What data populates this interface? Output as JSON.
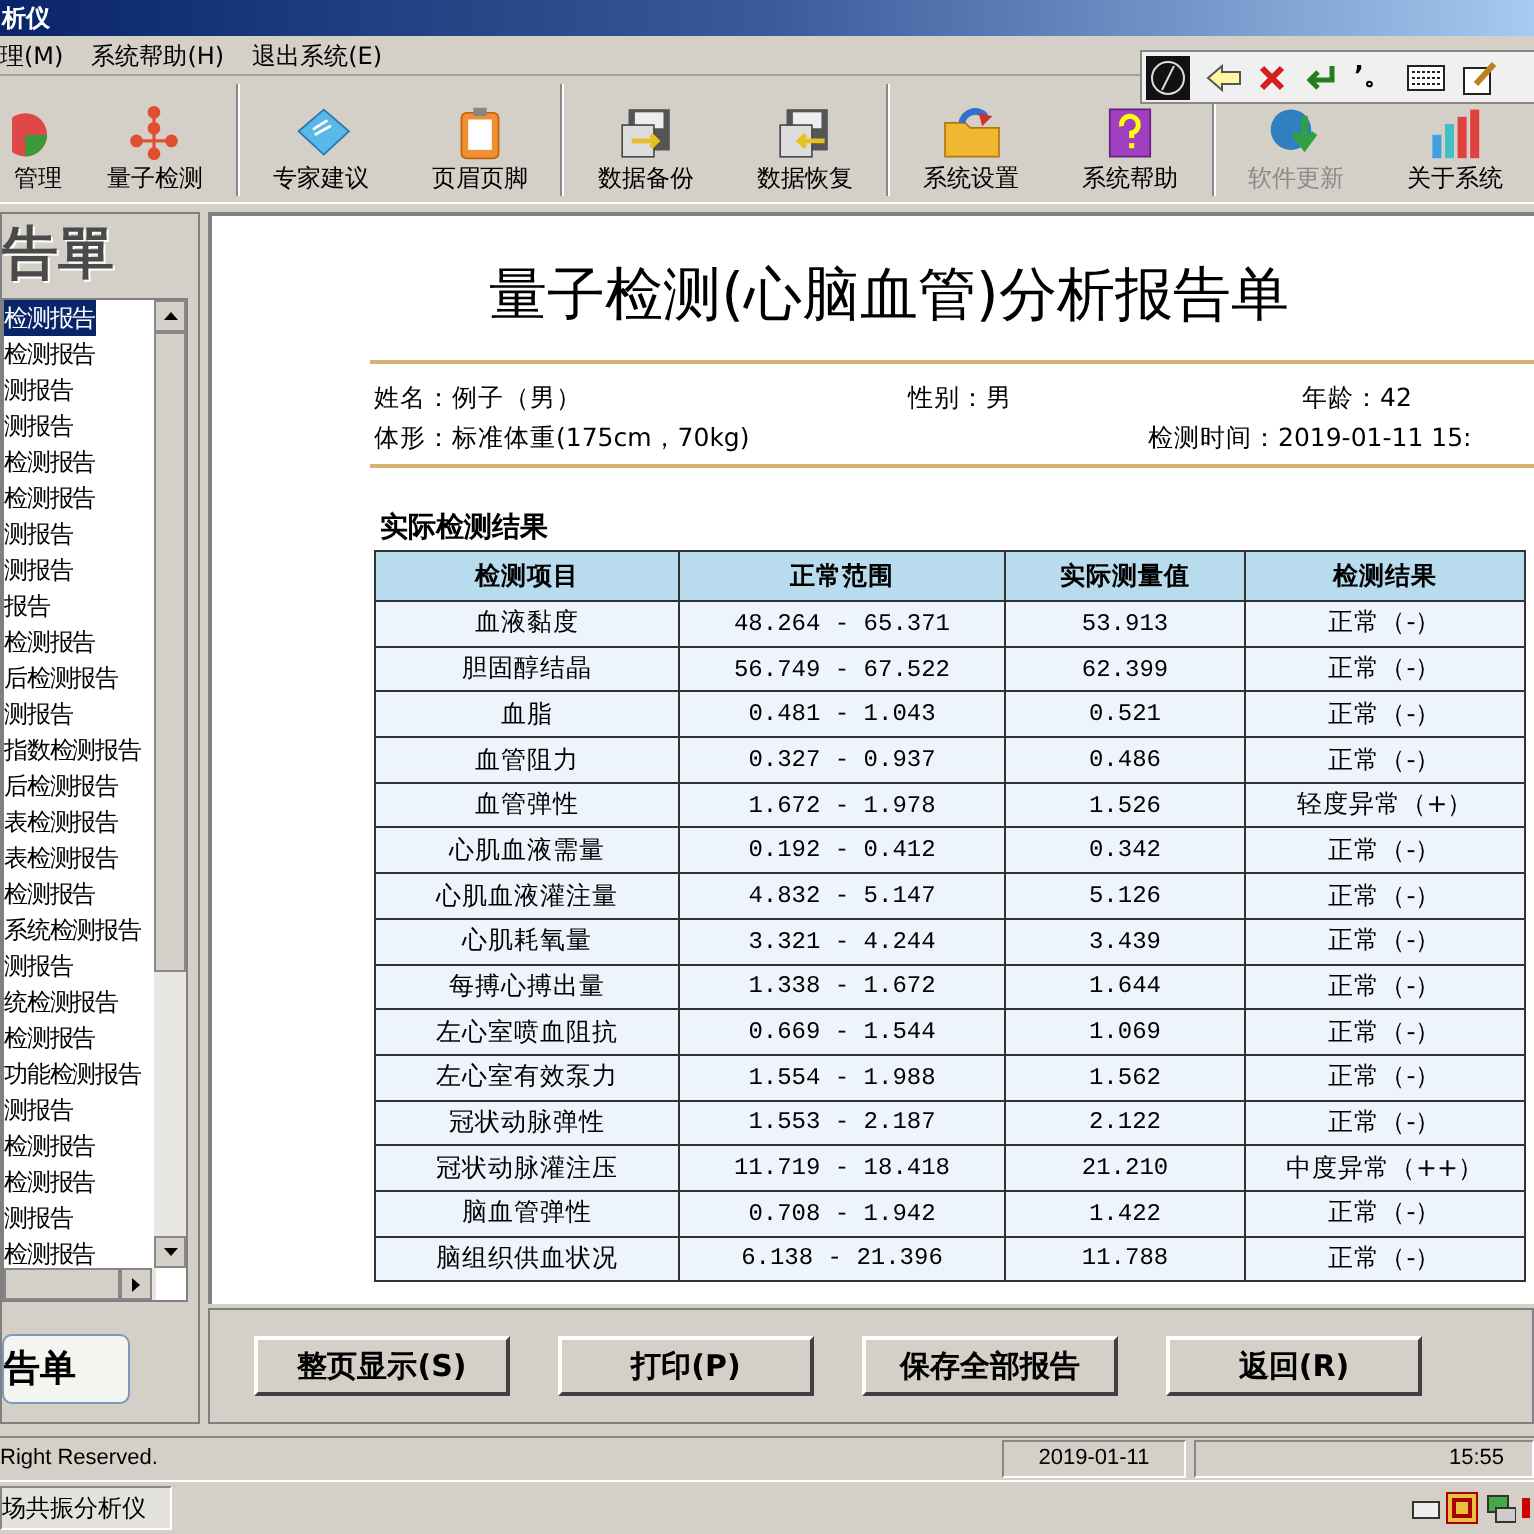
{
  "title_bar": {
    "title": "析仪"
  },
  "menu": [
    "理(M)",
    "系统帮助(H)",
    "退出系统(E)"
  ],
  "toolbar": [
    {
      "label": "管理",
      "disabled": false
    },
    {
      "label": "量子检测",
      "disabled": false
    },
    {
      "label": "专家建议",
      "disabled": false
    },
    {
      "label": "页眉页脚",
      "disabled": false
    },
    {
      "label": "数据备份",
      "disabled": false
    },
    {
      "label": "数据恢复",
      "disabled": false
    },
    {
      "label": "系统设置",
      "disabled": false
    },
    {
      "label": "系统帮助",
      "disabled": false
    },
    {
      "label": "软件更新",
      "disabled": true
    },
    {
      "label": "关于系统",
      "disabled": false
    }
  ],
  "ime_toolbar": {
    "punct": "’。"
  },
  "sidebar": {
    "header": "告單",
    "items": [
      {
        "label": "检测报告",
        "selected": true
      },
      {
        "label": "检测报告",
        "selected": false
      },
      {
        "label": "测报告",
        "selected": false
      },
      {
        "label": "测报告",
        "selected": false
      },
      {
        "label": "检测报告",
        "selected": false
      },
      {
        "label": "检测报告",
        "selected": false
      },
      {
        "label": "测报告",
        "selected": false
      },
      {
        "label": "测报告",
        "selected": false
      },
      {
        "label": "报告",
        "selected": false
      },
      {
        "label": "检测报告",
        "selected": false
      },
      {
        "label": "后检测报告",
        "selected": false
      },
      {
        "label": "测报告",
        "selected": false
      },
      {
        "label": "指数检测报告",
        "selected": false
      },
      {
        "label": "后检测报告",
        "selected": false
      },
      {
        "label": "表检测报告",
        "selected": false
      },
      {
        "label": "表检测报告",
        "selected": false
      },
      {
        "label": "检测报告",
        "selected": false
      },
      {
        "label": "系统检测报告",
        "selected": false
      },
      {
        "label": "测报告",
        "selected": false
      },
      {
        "label": "统检测报告",
        "selected": false
      },
      {
        "label": "检测报告",
        "selected": false
      },
      {
        "label": "功能检测报告",
        "selected": false
      },
      {
        "label": "测报告",
        "selected": false
      },
      {
        "label": "检测报告",
        "selected": false
      },
      {
        "label": "检测报告",
        "selected": false
      },
      {
        "label": "测报告",
        "selected": false
      },
      {
        "label": "检测报告",
        "selected": false
      }
    ],
    "button": "告单"
  },
  "report": {
    "title": "量子检测(心脑血管)分析报告单",
    "name": {
      "label": "姓名：",
      "value": "例子（男）"
    },
    "gender": {
      "label": "性别：",
      "value": "男"
    },
    "age": {
      "label": "年龄：",
      "value": "42"
    },
    "body": {
      "label": "体形：",
      "value": "标准体重(175cm，70kg)"
    },
    "time": {
      "label": "检测时间：",
      "value": "2019-01-11 15:"
    },
    "section_title": "实际检测结果",
    "columns": [
      "检测项目",
      "正常范围",
      "实际测量值",
      "检测结果"
    ],
    "rows": [
      {
        "item": "血液黏度",
        "range": "48.264 - 65.371",
        "value": "53.913",
        "result": "正常（-）"
      },
      {
        "item": "胆固醇结晶",
        "range": "56.749 - 67.522",
        "value": "62.399",
        "result": "正常（-）"
      },
      {
        "item": "血脂",
        "range": "0.481 - 1.043",
        "value": "0.521",
        "result": "正常（-）"
      },
      {
        "item": "血管阻力",
        "range": "0.327 - 0.937",
        "value": "0.486",
        "result": "正常（-）"
      },
      {
        "item": "血管弹性",
        "range": "1.672 - 1.978",
        "value": "1.526",
        "result": "轻度异常（+）"
      },
      {
        "item": "心肌血液需量",
        "range": "0.192 - 0.412",
        "value": "0.342",
        "result": "正常（-）"
      },
      {
        "item": "心肌血液灌注量",
        "range": "4.832 - 5.147",
        "value": "5.126",
        "result": "正常（-）"
      },
      {
        "item": "心肌耗氧量",
        "range": "3.321 - 4.244",
        "value": "3.439",
        "result": "正常（-）"
      },
      {
        "item": "每搏心搏出量",
        "range": "1.338 - 1.672",
        "value": "1.644",
        "result": "正常（-）"
      },
      {
        "item": "左心室喷血阻抗",
        "range": "0.669 - 1.544",
        "value": "1.069",
        "result": "正常（-）"
      },
      {
        "item": "左心室有效泵力",
        "range": "1.554 - 1.988",
        "value": "1.562",
        "result": "正常（-）"
      },
      {
        "item": "冠状动脉弹性",
        "range": "1.553 - 2.187",
        "value": "2.122",
        "result": "正常（-）"
      },
      {
        "item": "冠状动脉灌注压",
        "range": "11.719 - 18.418",
        "value": "21.210",
        "result": "中度异常（++）"
      },
      {
        "item": "脑血管弹性",
        "range": "0.708 - 1.942",
        "value": "1.422",
        "result": "正常（-）"
      },
      {
        "item": "脑组织供血状况",
        "range": "6.138 - 21.396",
        "value": "11.788",
        "result": "正常（-）"
      }
    ]
  },
  "buttons": [
    "整页显示(S)",
    "打印(P)",
    "保存全部报告",
    "返回(R)"
  ],
  "status_bar": {
    "copyright": "Right Reserved.",
    "date": "2019-01-11",
    "time": "15:55"
  },
  "taskbar": {
    "app": "场共振分析仪"
  }
}
